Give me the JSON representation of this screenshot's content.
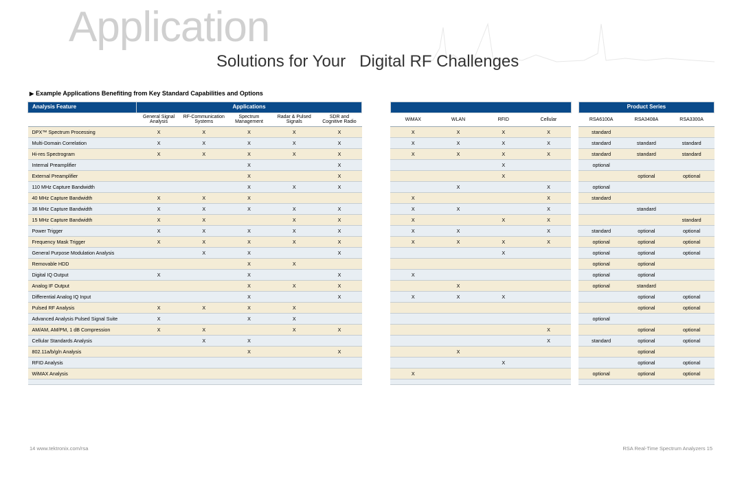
{
  "bg_title": "Application",
  "subtitle_a": "Solutions for Your",
  "subtitle_b": "Digital RF Challenges",
  "example_line": "Example Applications Benefiting from Key Standard Capabilities and Options",
  "groups": {
    "feature": "Analysis Feature",
    "apps": "Applications",
    "products": "Product Series"
  },
  "app_cols": [
    "General Signal\nAnalysis",
    "RF-Communication\nSystems",
    "Spectrum\nManagement",
    "Radar & Pulsed\nSignals",
    "SDR and\nCognitive Radio",
    "WiMAX",
    "WLAN",
    "RFID",
    "Cellular"
  ],
  "prod_cols": [
    "RSA6100A",
    "RSA3408A",
    "RSA3300A"
  ],
  "rows": [
    {
      "f": "DPX™ Spectrum Processing",
      "a": [
        "X",
        "X",
        "X",
        "X",
        "X",
        "X",
        "X",
        "X",
        "X"
      ],
      "p": [
        "standard",
        "",
        ""
      ]
    },
    {
      "f": "Multi-Domain Correlation",
      "a": [
        "X",
        "X",
        "X",
        "X",
        "X",
        "X",
        "X",
        "X",
        "X"
      ],
      "p": [
        "standard",
        "standard",
        "standard"
      ]
    },
    {
      "f": "Hi-res Spectrogram",
      "a": [
        "X",
        "X",
        "X",
        "X",
        "X",
        "X",
        "X",
        "X",
        "X"
      ],
      "p": [
        "standard",
        "standard",
        "standard"
      ]
    },
    {
      "f": "Internal Preamplifier",
      "a": [
        "",
        "",
        "X",
        "",
        "X",
        "",
        "",
        "X",
        ""
      ],
      "p": [
        "optional",
        "",
        ""
      ]
    },
    {
      "f": "External Preamplifier",
      "a": [
        "",
        "",
        "X",
        "",
        "X",
        "",
        "",
        "X",
        ""
      ],
      "p": [
        "",
        "optional",
        "optional"
      ]
    },
    {
      "f": "110 MHz Capture Bandwidth",
      "a": [
        "",
        "",
        "X",
        "X",
        "X",
        "",
        "X",
        "",
        "X"
      ],
      "p": [
        "optional",
        "",
        ""
      ]
    },
    {
      "f": "40 MHz Capture Bandwidth",
      "a": [
        "X",
        "X",
        "X",
        "",
        "",
        "X",
        "",
        "",
        "X"
      ],
      "p": [
        "standard",
        "",
        ""
      ]
    },
    {
      "f": "36 MHz Capture Bandwidth",
      "a": [
        "X",
        "X",
        "X",
        "X",
        "X",
        "X",
        "X",
        "",
        "X"
      ],
      "p": [
        "",
        "standard",
        ""
      ]
    },
    {
      "f": "15 MHz Capture Bandwidth",
      "a": [
        "X",
        "X",
        "",
        "X",
        "X",
        "X",
        "",
        "X",
        "X"
      ],
      "p": [
        "",
        "",
        "standard"
      ]
    },
    {
      "f": "Power Trigger",
      "a": [
        "X",
        "X",
        "X",
        "X",
        "X",
        "X",
        "X",
        "",
        "X"
      ],
      "p": [
        "standard",
        "optional",
        "optional"
      ]
    },
    {
      "f": "Frequency Mask Trigger",
      "a": [
        "X",
        "X",
        "X",
        "X",
        "X",
        "X",
        "X",
        "X",
        "X"
      ],
      "p": [
        "optional",
        "optional",
        "optional"
      ]
    },
    {
      "f": "General Purpose Modulation Analysis",
      "a": [
        "",
        "X",
        "X",
        "",
        "X",
        "",
        "",
        "X",
        ""
      ],
      "p": [
        "optional",
        "optional",
        "optional"
      ]
    },
    {
      "f": "Removable HDD",
      "a": [
        "",
        "",
        "X",
        "X",
        "",
        "",
        "",
        "",
        ""
      ],
      "p": [
        "optional",
        "optional",
        ""
      ]
    },
    {
      "f": "Digital IQ Output",
      "a": [
        "X",
        "",
        "X",
        "",
        "X",
        "X",
        "",
        "",
        ""
      ],
      "p": [
        "optional",
        "optional",
        ""
      ]
    },
    {
      "f": "Analog IF Output",
      "a": [
        "",
        "",
        "X",
        "X",
        "X",
        "",
        "X",
        "",
        ""
      ],
      "p": [
        "optional",
        "standard",
        ""
      ]
    },
    {
      "f": "Differential Analog IQ Input",
      "a": [
        "",
        "",
        "X",
        "",
        "X",
        "X",
        "X",
        "X",
        ""
      ],
      "p": [
        "",
        "optional",
        "optional"
      ]
    },
    {
      "f": "Pulsed RF Analysis",
      "a": [
        "X",
        "X",
        "X",
        "X",
        "",
        "",
        "",
        "",
        ""
      ],
      "p": [
        "",
        "optional",
        "optional"
      ]
    },
    {
      "f": "Advanced Analysis Pulsed Signal Suite",
      "a": [
        "X",
        "",
        "X",
        "X",
        "",
        "",
        "",
        "",
        ""
      ],
      "p": [
        "optional",
        "",
        ""
      ]
    },
    {
      "f": "AM/AM, AM/PM, 1 dB Compression",
      "a": [
        "X",
        "X",
        "",
        "X",
        "X",
        "",
        "",
        "",
        "X"
      ],
      "p": [
        "",
        "optional",
        "optional"
      ]
    },
    {
      "f": "Cellular Standards Analysis",
      "a": [
        "",
        "X",
        "X",
        "",
        "",
        "",
        "",
        "",
        "X"
      ],
      "p": [
        "standard",
        "optional",
        "optional"
      ]
    },
    {
      "f": "802.11a/b/g/n Analysis",
      "a": [
        "",
        "",
        "X",
        "",
        "X",
        "",
        "X",
        "",
        ""
      ],
      "p": [
        "",
        "optional",
        ""
      ]
    },
    {
      "f": "RFID Analysis",
      "a": [
        "",
        "",
        "",
        "",
        "",
        "",
        "",
        "X",
        ""
      ],
      "p": [
        "",
        "optional",
        "optional"
      ]
    },
    {
      "f": "WiMAX Analysis",
      "a": [
        "",
        "",
        "",
        "",
        "",
        "X",
        "",
        "",
        ""
      ],
      "p": [
        "optional",
        "optional",
        "optional"
      ]
    }
  ],
  "footer_left_num": "14 ",
  "footer_left": "www.tektronix.com/rsa",
  "footer_right": "RSA Real-Time Spectrum Analyzers ",
  "footer_right_num": "15"
}
